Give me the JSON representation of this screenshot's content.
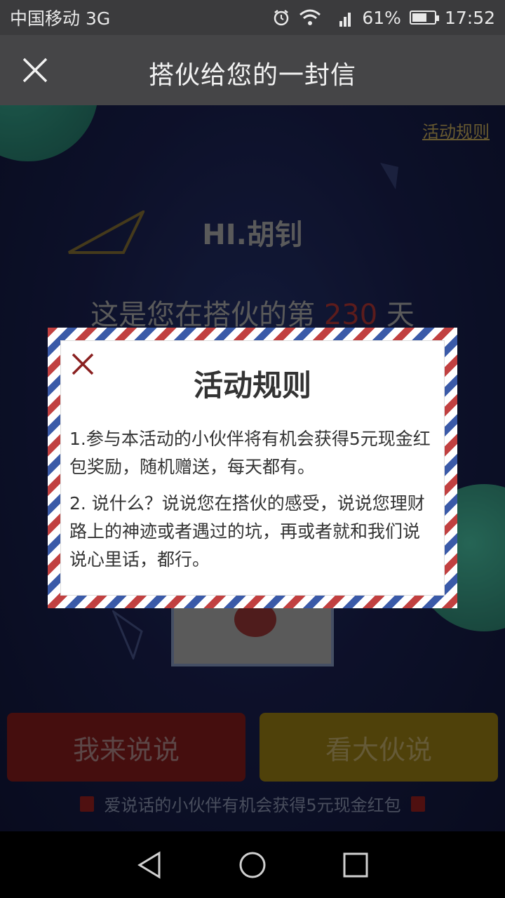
{
  "status_bar": {
    "carrier": "中国移动 3G",
    "battery": "61%",
    "time": "17:52"
  },
  "header": {
    "title": "搭伙给您的一封信"
  },
  "main": {
    "rules_link": "活动规则",
    "greeting": "HI.胡钊",
    "days_prefix": "这是您在搭伙的第",
    "days_count": "230",
    "days_suffix": "天",
    "buttons": {
      "say": "我来说说",
      "others": "看大伙说"
    },
    "footer_note": "爱说话的小伙伴有机会获得5元现金红包"
  },
  "modal": {
    "title": "活动规则",
    "rules": [
      "1.参与本活动的小伙伴将有机会获得5元现金红包奖励，随机赠送，每天都有。",
      "2. 说什么？说说您在搭伙的感受，说说您理财路上的神迹或者遇过的坑，再或者就和我们说说心里话，都行。"
    ]
  },
  "colors": {
    "accent_red": "#8e2b2b",
    "button_red": "#6a1616",
    "button_gold": "#7a6410"
  }
}
